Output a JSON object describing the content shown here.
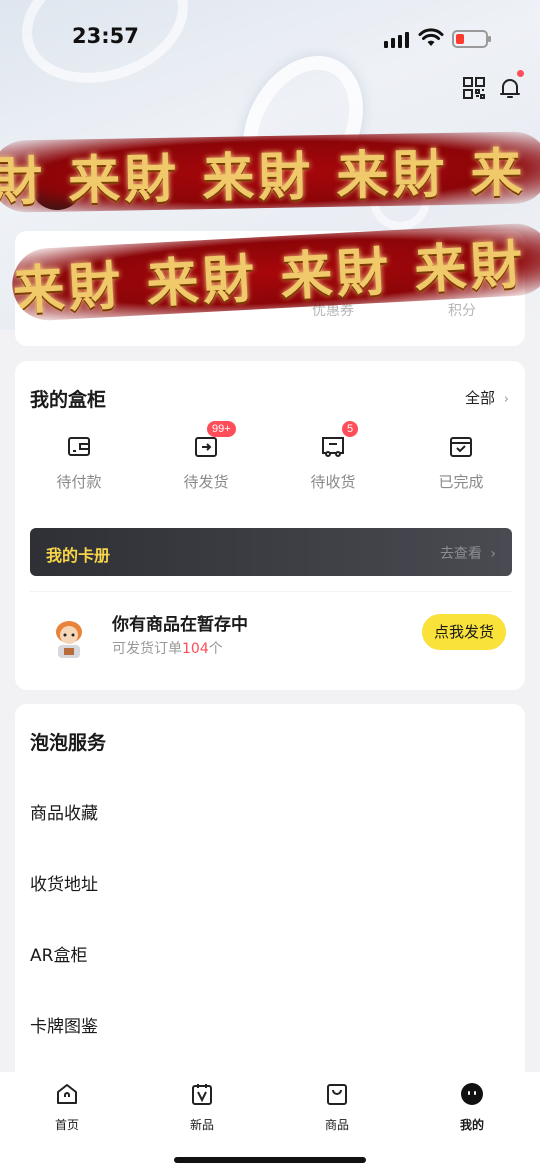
{
  "status_bar": {
    "time": "23:57"
  },
  "banner": {
    "repeat_text": "財 来財 来財 来財 来",
    "repeat_text_2": "来財 来財 来財 来財"
  },
  "profile": {
    "stats": [
      {
        "label": "优惠券"
      },
      {
        "label": "积分"
      }
    ]
  },
  "my_box": {
    "title": "我的盒柜",
    "all_label": "全部",
    "items": [
      {
        "label": "待付款",
        "icon": "wallet-icon",
        "badge": ""
      },
      {
        "label": "待发货",
        "icon": "outbox-icon",
        "badge": "99+"
      },
      {
        "label": "待收货",
        "icon": "truck-icon",
        "badge": "5"
      },
      {
        "label": "已完成",
        "icon": "done-box-icon",
        "badge": ""
      }
    ],
    "card_album": {
      "title": "我的卡册",
      "link": "去查看"
    },
    "stash": {
      "title": "你有商品在暂存中",
      "sub_prefix": "可发货订单",
      "count": "104",
      "sub_suffix": "个",
      "button": "点我发货"
    }
  },
  "services": {
    "title": "泡泡服务",
    "items": [
      "商品收藏",
      "收货地址",
      "AR盒柜",
      "卡牌图鉴"
    ]
  },
  "tabbar": {
    "tabs": [
      {
        "label": "首页",
        "icon": "home-icon"
      },
      {
        "label": "新品",
        "icon": "calendar-v-icon"
      },
      {
        "label": "商品",
        "icon": "bag-icon"
      },
      {
        "label": "我的",
        "icon": "profile-face-icon"
      }
    ]
  },
  "colors": {
    "accent_yellow": "#f9e23a",
    "badge_red": "#ff4d5a",
    "banner_red": "#a8070b",
    "album_gold": "#f7d54a"
  }
}
